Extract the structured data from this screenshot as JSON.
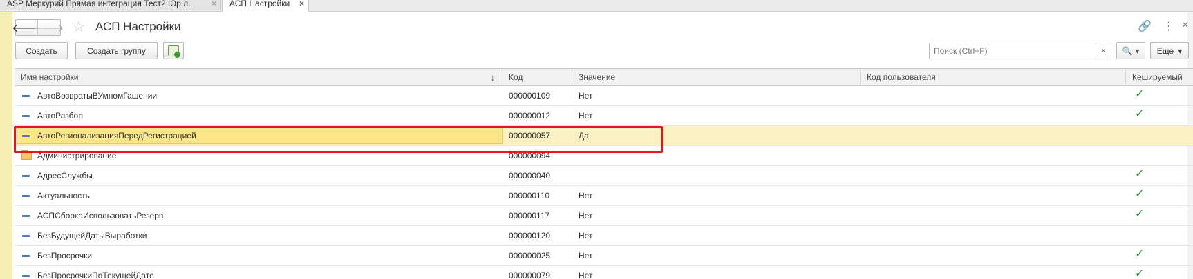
{
  "tabs": [
    {
      "label": "ASP Меркурий Прямая интеграция Тест2 Юр.л.",
      "close": "×"
    },
    {
      "label": "АСП Настройки",
      "close": "×"
    }
  ],
  "header": {
    "back_glyph": "🡐",
    "forward_glyph": "🡒",
    "favorite_glyph": "☆",
    "title": "АСП Настройки",
    "link_glyph": "🔗",
    "menu_glyph": "⋮",
    "close_glyph": "×"
  },
  "toolbar": {
    "create_label": "Создать",
    "create_group_label": "Создать группу",
    "search_placeholder": "Поиск (Ctrl+F)",
    "search_clear": "×",
    "search_glyph": "🔍",
    "dropdown_glyph": "▾",
    "more_label": "Еще",
    "more_arrow": "▾"
  },
  "table": {
    "columns": [
      "Имя настройки",
      "Код",
      "Значение",
      "Код пользователя",
      "Кешируемый"
    ],
    "sort_glyph": "↓",
    "check_glyph": "✓",
    "rows": [
      {
        "name": "АвтоВозвратыВУмномГашении",
        "code": "000000109",
        "value": "Нет",
        "user_code": "",
        "cached": true,
        "kind": "item"
      },
      {
        "name": "АвтоРазбор",
        "code": "000000012",
        "value": "Нет",
        "user_code": "",
        "cached": true,
        "kind": "item"
      },
      {
        "name": "АвтоРегионализацияПередРегистрацией",
        "code": "000000057",
        "value": "Да",
        "user_code": "",
        "cached": false,
        "kind": "item",
        "selected": true
      },
      {
        "name": "Администрирование",
        "code": "000000094",
        "value": "",
        "user_code": "",
        "cached": false,
        "kind": "folder"
      },
      {
        "name": "АдресСлужбы",
        "code": "000000040",
        "value": "",
        "user_code": "",
        "cached": true,
        "kind": "item"
      },
      {
        "name": "Актуальность",
        "code": "000000110",
        "value": "Нет",
        "user_code": "",
        "cached": true,
        "kind": "item"
      },
      {
        "name": "АСПСборкаИспользоватьРезерв",
        "code": "000000117",
        "value": "Нет",
        "user_code": "",
        "cached": true,
        "kind": "item"
      },
      {
        "name": "БезБудущейДатыВыработки",
        "code": "000000120",
        "value": "Нет",
        "user_code": "",
        "cached": false,
        "kind": "item"
      },
      {
        "name": "БезПросрочки",
        "code": "000000025",
        "value": "Нет",
        "user_code": "",
        "cached": true,
        "kind": "item"
      },
      {
        "name": "БезПросрочкиПоТекущейДате",
        "code": "000000079",
        "value": "Нет",
        "user_code": "",
        "cached": true,
        "kind": "item"
      }
    ]
  },
  "colors": {
    "accent_highlight": "#e8141a",
    "selected_row": "#fbf0c2",
    "check": "#2e9a3c"
  }
}
